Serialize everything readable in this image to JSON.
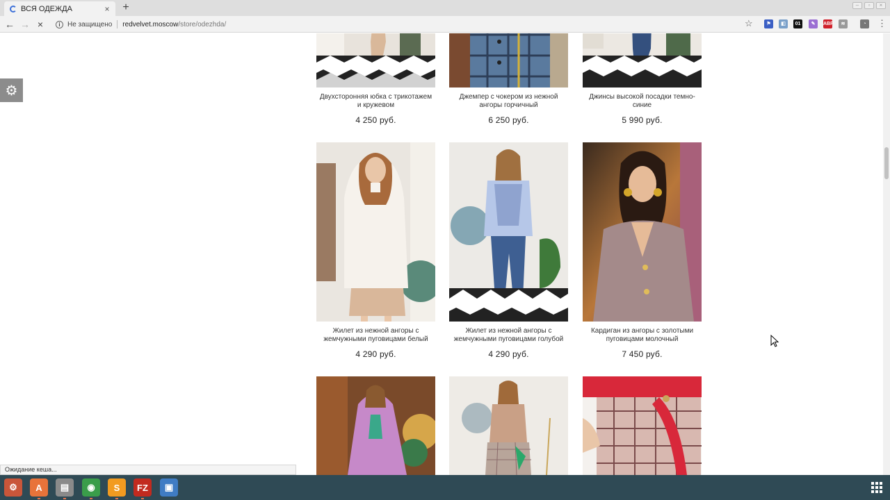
{
  "browser": {
    "tab_title": "ВСЯ ОДЕЖДА",
    "tab_close": "×",
    "new_tab": "+",
    "security_label": "Не защищено",
    "url_host": "redvelvet.moscow",
    "url_path": "/store/odezhda/",
    "extensions": [
      {
        "name": "flag-extension-icon",
        "glyph": "⚑",
        "color": "#3b5fc4"
      },
      {
        "name": "window-extension-icon",
        "glyph": "◧",
        "color": "#7aa0c9"
      },
      {
        "name": "counter-extension-icon",
        "glyph": "01",
        "color": "#111111"
      },
      {
        "name": "pen-extension-icon",
        "glyph": "✎",
        "color": "#9b6fd3"
      },
      {
        "name": "adblock-icon",
        "glyph": "ABP",
        "color": "#d0202a"
      },
      {
        "name": "layers-extension-icon",
        "glyph": "≋",
        "color": "#9a9a9a"
      },
      {
        "name": "profile-icon",
        "glyph": "◔",
        "color": "#777777"
      }
    ]
  },
  "status_text": "Ожидание кеша...",
  "products": [
    {
      "name": "Двухсторонняя юбка с трикотажем и кружевом",
      "price": "4 250 руб."
    },
    {
      "name": "Джемпер с чокером из нежной ангоры горчичный",
      "price": "6 250 руб."
    },
    {
      "name": "Джинсы высокой посадки темно-синие",
      "price": "5 990 руб."
    },
    {
      "name": "Жилет из нежной ангоры с жемчужными пуговицами белый",
      "price": "4 290 руб."
    },
    {
      "name": "Жилет из нежной ангоры с жемчужными пуговицами голубой",
      "price": "4 290 руб."
    },
    {
      "name": "Кардиган из ангоры с золотыми пуговицами молочный",
      "price": "7 450 руб."
    },
    {
      "name": "",
      "price": ""
    },
    {
      "name": "",
      "price": ""
    },
    {
      "name": "",
      "price": ""
    }
  ],
  "taskbar": [
    {
      "name": "settings-app-icon",
      "glyph": "⚙",
      "color": "#c9563a"
    },
    {
      "name": "software-center-icon",
      "glyph": "A",
      "color": "#e8733a"
    },
    {
      "name": "file-manager-icon",
      "glyph": "▤",
      "color": "#8a8a8a"
    },
    {
      "name": "chrome-icon",
      "glyph": "◉",
      "color": "#3a9d4a"
    },
    {
      "name": "sublime-text-icon",
      "glyph": "S",
      "color": "#f29b20"
    },
    {
      "name": "filezilla-icon",
      "glyph": "FZ",
      "color": "#c22a1f"
    },
    {
      "name": "screenshot-app-icon",
      "glyph": "▣",
      "color": "#3f7cc4"
    }
  ]
}
